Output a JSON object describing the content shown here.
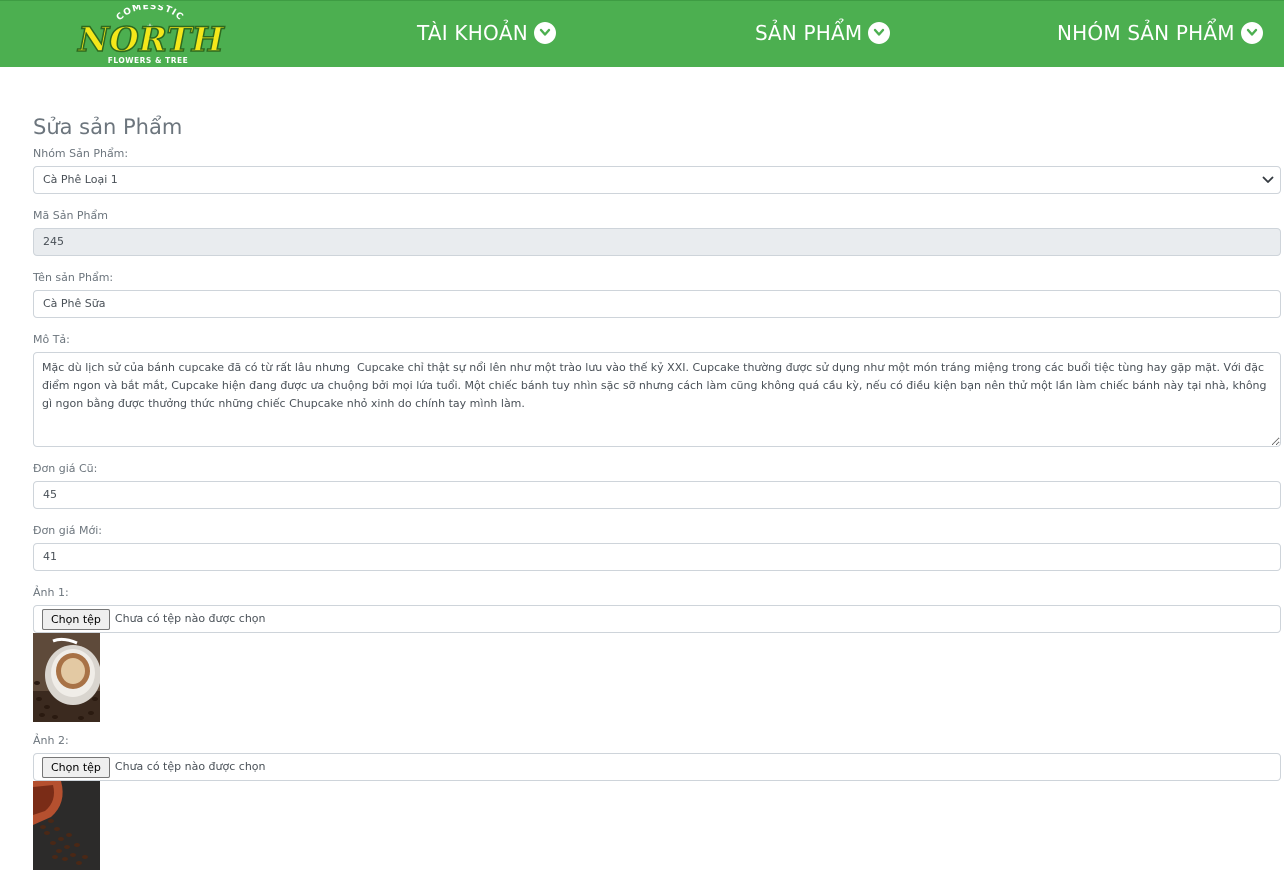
{
  "header": {
    "logo": {
      "top": "COMESSTIC",
      "main": "NORTH",
      "bottom": "FLOWERS & TREE"
    },
    "nav": [
      {
        "label": "TÀI KHOẢN",
        "icon": "chevron-down-circle-icon"
      },
      {
        "label": "SẢN PHẨM",
        "icon": "chevron-down-circle-icon"
      },
      {
        "label": "NHÓM SẢN PHẨM",
        "icon": "chevron-down-circle-icon"
      }
    ]
  },
  "form": {
    "title": "Sửa sản Phẩm",
    "group": {
      "label": "Nhóm Sản Phẩm:",
      "selected": "Cà Phê Loại 1"
    },
    "code": {
      "label": "Mã Sản Phẩm",
      "value": "245"
    },
    "name": {
      "label": "Tên sản Phẩm:",
      "value": "Cà Phê Sữa"
    },
    "description": {
      "label": "Mô Tả:",
      "value": "Mặc dù lịch sử của bánh cupcake đã có từ rất lâu nhưng  Cupcake chỉ thật sự nổi lên như một trào lưu vào thế kỷ XXI. Cupcake thường được sử dụng như một món tráng miệng trong các buổi tiệc tùng hay gặp mặt. Với đặc điểm ngon và bắt mắt, Cupcake hiện đang được ưa chuộng bởi mọi lứa tuổi. Một chiếc bánh tuy nhìn sặc sỡ nhưng cách làm cũng không quá cầu kỳ, nếu có điều kiện bạn nên thử một lần làm chiếc bánh này tại nhà, không gì ngon bằng được thưởng thức những chiếc Chupcake nhỏ xinh do chính tay mình làm."
    },
    "old_price": {
      "label": "Đơn giá Cũ:",
      "value": "45"
    },
    "new_price": {
      "label": "Đơn giá Mới:",
      "value": "41"
    },
    "image1": {
      "label": "Ảnh 1:",
      "button": "Chọn tệp",
      "status": "Chưa có tệp nào được chọn"
    },
    "image2": {
      "label": "Ảnh 2:",
      "button": "Chọn tệp",
      "status": "Chưa có tệp nào được chọn"
    }
  },
  "colors": {
    "header_bg": "#4caf50",
    "logo_yellow": "#f5e71a",
    "input_border": "#ced4da",
    "readonly_bg": "#e9ecef"
  }
}
